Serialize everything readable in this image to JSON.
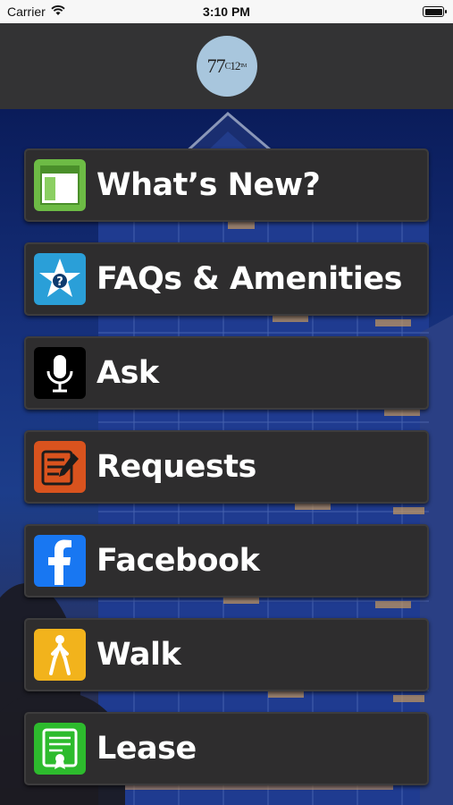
{
  "status_bar": {
    "carrier": "Carrier",
    "time": "3:10 PM",
    "icons": [
      "wifi-icon",
      "battery-icon"
    ]
  },
  "header": {
    "logo_main": "77",
    "logo_sup": "C",
    "logo_sub": "12",
    "logo_tm": "TM",
    "logo_color": "#a8c6dd",
    "background_color": "#333334"
  },
  "menu": {
    "items": [
      {
        "label": "What’s New?",
        "icon": "newspaper-icon",
        "icon_color": "#6dbb45"
      },
      {
        "label": "FAQs & Amenities",
        "icon": "star-question-icon",
        "icon_color": "#2a9fd8"
      },
      {
        "label": "Ask",
        "icon": "microphone-icon",
        "icon_color": "#000000"
      },
      {
        "label": "Requests",
        "icon": "edit-document-icon",
        "icon_color": "#d9531e"
      },
      {
        "label": "Facebook",
        "icon": "facebook-icon",
        "icon_color": "#1877f2"
      },
      {
        "label": "Walk",
        "icon": "walking-person-icon",
        "icon_color": "#f2b31c"
      },
      {
        "label": "Lease",
        "icon": "certificate-icon",
        "icon_color": "#2dbb2d"
      }
    ]
  }
}
